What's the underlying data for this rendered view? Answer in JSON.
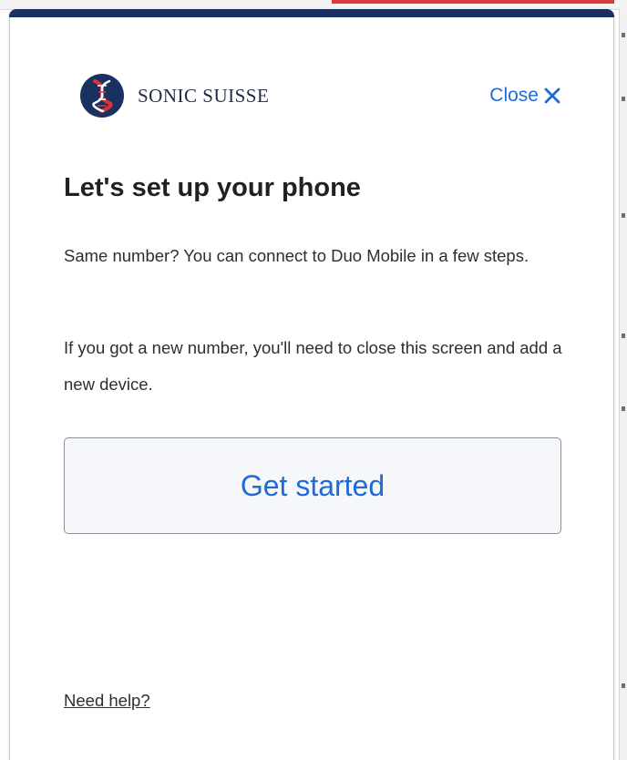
{
  "brand": {
    "name": "SONIC SUISSE",
    "logo_icon": "dna-helix-logo-icon",
    "logo_colors": {
      "background": "#1a3060",
      "helix_red": "#d8343a",
      "helix_white": "#ffffff"
    }
  },
  "header": {
    "close_label": "Close",
    "close_icon": "close-x-icon"
  },
  "content": {
    "title": "Let's set up your phone",
    "paragraph_1": "Same number? You can connect to Duo Mobile in a few steps.",
    "paragraph_2": "If you got a new number, you'll need to close this screen and add a new device."
  },
  "actions": {
    "get_started_label": "Get started"
  },
  "footer": {
    "help_label": "Need help?"
  },
  "colors": {
    "accent": "#1f6bd6",
    "top_bar": "#1a3060",
    "text": "#1e2126",
    "button_bg": "#f5f7fa",
    "button_border": "#8a919c"
  }
}
